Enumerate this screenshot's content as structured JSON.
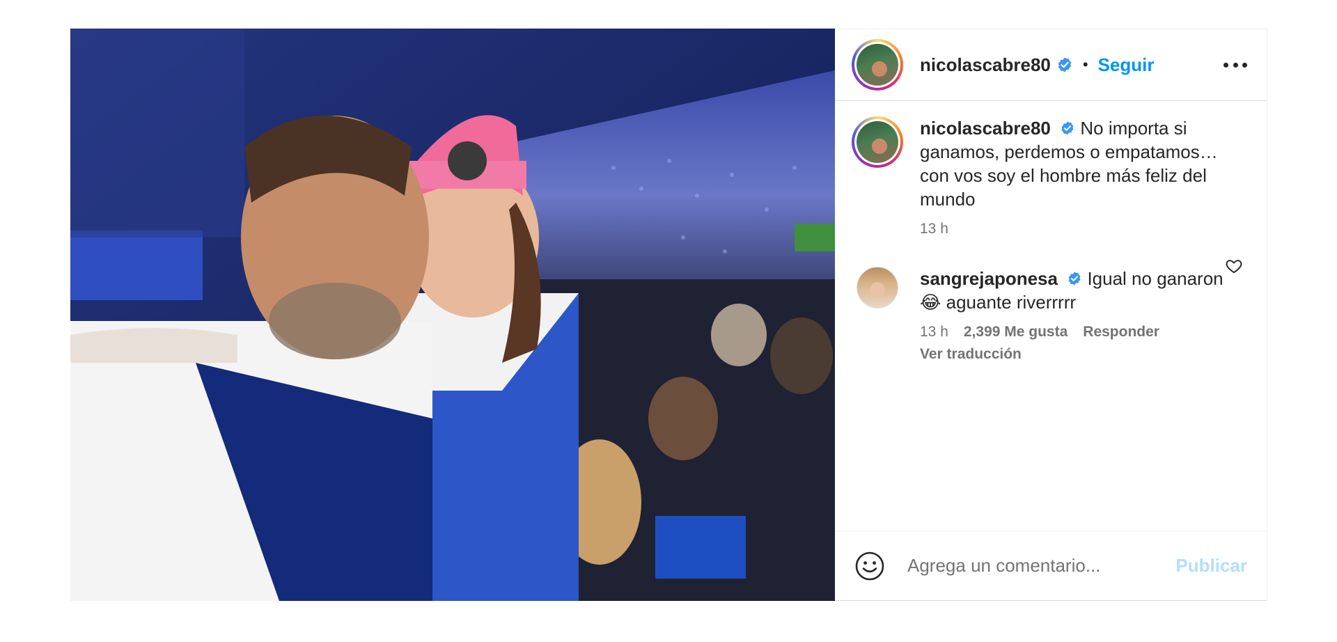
{
  "post": {
    "header": {
      "username": "nicolascabre80",
      "separator": "•",
      "follow_label": "Seguir"
    },
    "caption": {
      "username": "nicolascabre80",
      "text": "No importa si ganamos, perdemos o empatamos… con vos soy el hombre más feliz del mundo",
      "time": "13 h"
    },
    "comment": {
      "username": "sangrejaponesa",
      "text_before_emoji": "Igual no ganaron",
      "emoji": "😂",
      "text_after_emoji": "aguante riverrrrr",
      "time": "13 h",
      "likes": "2,399 Me gusta",
      "reply_label": "Responder",
      "translate_label": "Ver traducción"
    },
    "footer": {
      "placeholder": "Agrega un comentario...",
      "publish_label": "Publicar"
    }
  },
  "colors": {
    "accent": "#0095f6",
    "publish_disabled": "#b2dffc",
    "muted": "#737373",
    "verified": "#3897f0"
  },
  "icons": {
    "verified": "verified-badge-icon",
    "more": "more-options-icon",
    "heart": "heart-outline-icon",
    "emoji": "emoji-smiley-icon"
  }
}
